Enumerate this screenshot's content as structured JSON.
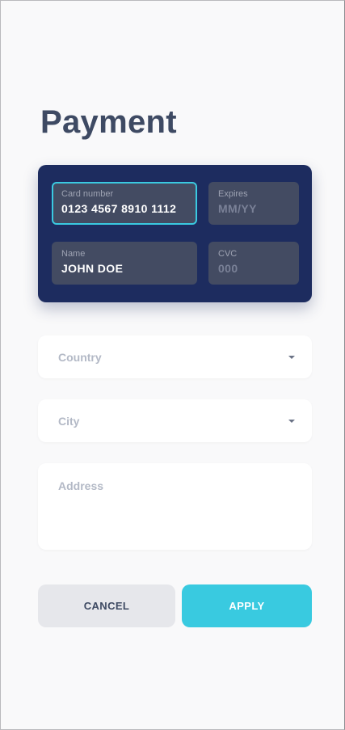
{
  "page": {
    "title": "Payment"
  },
  "card": {
    "number": {
      "label": "Card number",
      "value": "0123 4567 8910 1112"
    },
    "expires": {
      "label": "Expires",
      "placeholder": "MM/YY"
    },
    "name": {
      "label": "Name",
      "value": "JOHN DOE"
    },
    "cvc": {
      "label": "CVC",
      "placeholder": "000"
    }
  },
  "form": {
    "country": {
      "placeholder": "Country"
    },
    "city": {
      "placeholder": "City"
    },
    "address": {
      "placeholder": "Address"
    }
  },
  "actions": {
    "cancel_label": "CANCEL",
    "apply_label": "APPLY"
  },
  "colors": {
    "card_bg": "#1d2c5f",
    "field_bg": "#434b62",
    "accent": "#39cae0",
    "title": "#3e4a63",
    "placeholder": "#b3b9c6"
  },
  "icons": {
    "dropdown": "chevron-down-icon"
  }
}
